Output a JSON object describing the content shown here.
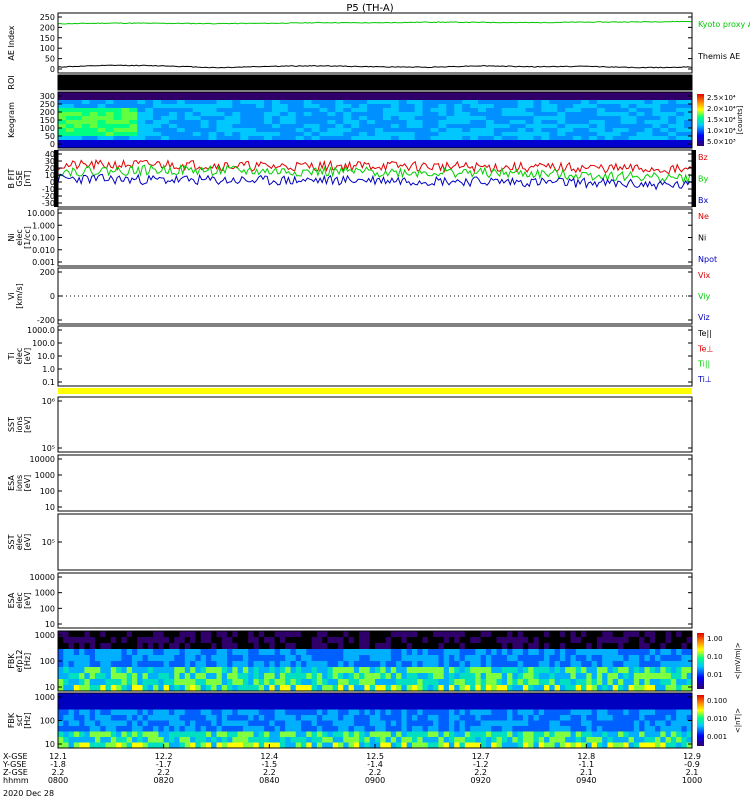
{
  "title": "P5 (TH-A)",
  "date_label": "2020 Dec 28",
  "colors": {
    "kyoto": "#00c800",
    "themis": "#000000",
    "red": "#e00000",
    "green": "#00d000",
    "blue": "#0000c0",
    "yellow": "#ffff00",
    "black": "#000000"
  },
  "chart_data": [
    {
      "id": "ae",
      "type": "line",
      "ylabel": "AE Index",
      "ylim": [
        0,
        250
      ],
      "yticks": [
        "250",
        "200",
        "150",
        "100",
        "50",
        "0"
      ],
      "series": [
        {
          "name": "Kyoto proxy AE",
          "name2": "",
          "color": "#00c800",
          "x": [
            0,
            5,
            10,
            15,
            20,
            25,
            30,
            35,
            40,
            45,
            50,
            55,
            60
          ],
          "y": [
            205,
            208,
            207,
            206,
            207,
            210,
            209,
            212,
            211,
            210,
            212,
            213,
            215
          ]
        },
        {
          "name": "Themis AE",
          "color": "#000000",
          "x": [
            0,
            5,
            10,
            15,
            20,
            25,
            30,
            35,
            40,
            45,
            50,
            55,
            60
          ],
          "y": [
            25,
            32,
            30,
            22,
            28,
            30,
            26,
            24,
            30,
            26,
            28,
            22,
            25
          ]
        }
      ]
    },
    {
      "id": "roi",
      "type": "line",
      "ylabel": "ROI",
      "ylim": [
        0,
        1
      ],
      "yticks": []
    },
    {
      "id": "keogram",
      "type": "heatmap",
      "ylabel": "Keogram",
      "ylim": [
        0,
        300
      ],
      "yticks": [
        "300",
        "250",
        "200",
        "150",
        "100",
        "50",
        "0"
      ],
      "colorbar": {
        "label": "[counts]",
        "ticks": [
          "2.5×10⁴",
          "2.0×10⁴",
          "1.5×10⁴",
          "1.0×10⁴",
          "5.0×10³"
        ]
      }
    },
    {
      "id": "bfit",
      "type": "line",
      "ylabel": "B FIT",
      "ylabel2": "GSE",
      "ylabel3": "[nT]",
      "ylim": [
        -40,
        40
      ],
      "yticks": [
        "40",
        "30",
        "20",
        "10",
        "0",
        "-10",
        "-20",
        "-30"
      ],
      "series": [
        {
          "name": "Bz",
          "color": "#e00000",
          "x": [
            0,
            10,
            20,
            30,
            40,
            50,
            60
          ],
          "y": [
            18,
            20,
            17,
            18,
            16,
            15,
            12
          ]
        },
        {
          "name": "By",
          "color": "#00d000",
          "x": [
            0,
            10,
            20,
            30,
            40,
            50,
            60
          ],
          "y": [
            10,
            12,
            10,
            9,
            8,
            5,
            0
          ]
        },
        {
          "name": "Bx",
          "color": "#0000c0",
          "x": [
            0,
            10,
            20,
            30,
            40,
            50,
            60
          ],
          "y": [
            0,
            -2,
            -3,
            -2,
            -4,
            -6,
            -10
          ]
        }
      ]
    },
    {
      "id": "ni",
      "type": "line",
      "ylabel": "Ni",
      "ylabel2": "elec",
      "ylabel3": "[1/cc]",
      "scale": "log",
      "yticks": [
        "10.000",
        "1.000",
        "0.100",
        "0.010",
        "0.001"
      ],
      "series": [
        {
          "name": "Ne",
          "color": "#e00000"
        },
        {
          "name": "Ni",
          "color": "#000000"
        },
        {
          "name": "Npot",
          "color": "#0000c0"
        }
      ]
    },
    {
      "id": "vi",
      "type": "line",
      "ylabel": "Vi",
      "ylabel3": "[km/s]",
      "yticks": [
        "200",
        "0",
        "-200"
      ],
      "series": [
        {
          "name": "Vix",
          "color": "#e00000"
        },
        {
          "name": "Viy",
          "color": "#00d000"
        },
        {
          "name": "Viz",
          "color": "#0000c0"
        }
      ]
    },
    {
      "id": "ti",
      "type": "line",
      "ylabel": "Ti",
      "ylabel2": "elec",
      "ylabel3": "[eV]",
      "scale": "log",
      "yticks": [
        "1000.0",
        "100.0",
        "10.0",
        "1.0",
        "0.1"
      ],
      "series": [
        {
          "name": "Te||",
          "color": "#000000"
        },
        {
          "name": "Te⊥",
          "color": "#e00000"
        },
        {
          "name": "Ti||",
          "color": "#00d000"
        },
        {
          "name": "Ti⊥",
          "color": "#0000c0"
        }
      ]
    },
    {
      "id": "sst1",
      "type": "heatmap",
      "ylabel": "SST",
      "ylabel2": "ions",
      "ylabel3": "[eV]",
      "yticks": [
        "10⁶",
        "10⁵"
      ]
    },
    {
      "id": "esa1",
      "type": "heatmap",
      "ylabel": "ESA",
      "ylabel2": "ions",
      "ylabel3": "[eV]",
      "yticks": [
        "10000",
        "1000",
        "100",
        "10"
      ]
    },
    {
      "id": "sst2",
      "type": "heatmap",
      "ylabel": "SST",
      "ylabel2": "elec",
      "ylabel3": "[eV]",
      "yticks": [
        "10⁵"
      ]
    },
    {
      "id": "esa2",
      "type": "heatmap",
      "ylabel": "ESA",
      "ylabel2": "elec",
      "ylabel3": "[eV]",
      "yticks": [
        "10000",
        "1000",
        "100",
        "10"
      ]
    },
    {
      "id": "fbk1",
      "type": "heatmap",
      "ylabel": "FBK",
      "ylabel2": "efp12",
      "ylabel3": "[Hz]",
      "yticks": [
        "1000",
        "100",
        "10"
      ],
      "colorbar": {
        "label": "<|mV/m|>",
        "ticks": [
          "1.00",
          "0.10",
          "0.01"
        ]
      }
    },
    {
      "id": "fbk2",
      "type": "heatmap",
      "ylabel": "FBK",
      "ylabel2": "scf",
      "ylabel3": "[Hz]",
      "yticks": [
        "1000",
        "100",
        "10"
      ],
      "colorbar": {
        "label": "<|nT|>",
        "ticks": [
          "0.100",
          "0.010",
          "0.001"
        ]
      }
    }
  ],
  "xaxis": {
    "row_labels": [
      "X-GSE",
      "Y-GSE",
      "Z-GSE",
      "hhmm"
    ],
    "columns": [
      [
        "12.1",
        "-1.8",
        "2.2",
        "0800"
      ],
      [
        "12.2",
        "-1.7",
        "2.2",
        "0820"
      ],
      [
        "12.4",
        "-1.5",
        "2.2",
        "0840"
      ],
      [
        "12.5",
        "-1.4",
        "2.2",
        "0900"
      ],
      [
        "12.7",
        "-1.2",
        "2.2",
        "0920"
      ],
      [
        "12.8",
        "-1.1",
        "2.1",
        "0940"
      ],
      [
        "12.9",
        "-0.9",
        "2.1",
        "1000"
      ]
    ]
  }
}
